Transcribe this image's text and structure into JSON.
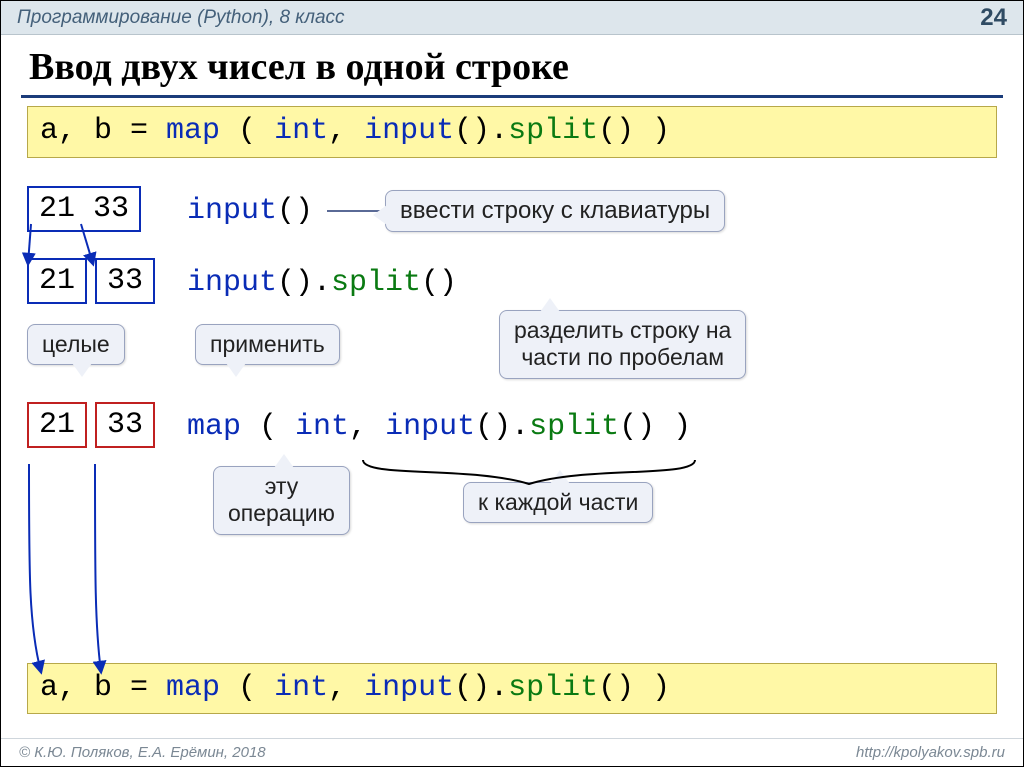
{
  "meta": {
    "course": "Программирование (Python), 8 класс",
    "page_no": "24",
    "copyright": "© К.Ю. Поляков, Е.А. Ерёмин, 2018",
    "url": "http://kpolyakov.spb.ru"
  },
  "title": "Ввод двух чисел в одной строке",
  "code_top": {
    "t1": "a, b = ",
    "t2": "map",
    "t3": " ( ",
    "t4": "int",
    "t5": ", ",
    "t6": "input",
    "t7": "().",
    "t8": "split",
    "t9": "() )"
  },
  "line1": {
    "box": "21 33",
    "code_a": "input",
    "code_b": "()",
    "callout": "ввести строку с клавиатуры"
  },
  "line2": {
    "box_a": "21",
    "box_b": "33",
    "code_a": "input",
    "code_b": "().",
    "code_c": "split",
    "code_d": "()",
    "callout_whole": "целые",
    "callout_apply": "применить",
    "callout_split": "разделить строку на\nчасти по пробелам"
  },
  "line3": {
    "box_a": "21",
    "box_b": "33",
    "code_a": "map",
    "code_b": " ( ",
    "code_c": "int",
    "code_d": ", ",
    "code_e": "input",
    "code_f": "().",
    "code_g": "split",
    "code_h": "() )",
    "callout_op": "эту\nоперацию",
    "callout_each": "к каждой части"
  },
  "code_bottom": {
    "t1": "a, b = ",
    "t2": "map",
    "t3": " ( ",
    "t4": "int",
    "t5": ", ",
    "t6": "input",
    "t7": "().",
    "t8": "split",
    "t9": "() )"
  }
}
